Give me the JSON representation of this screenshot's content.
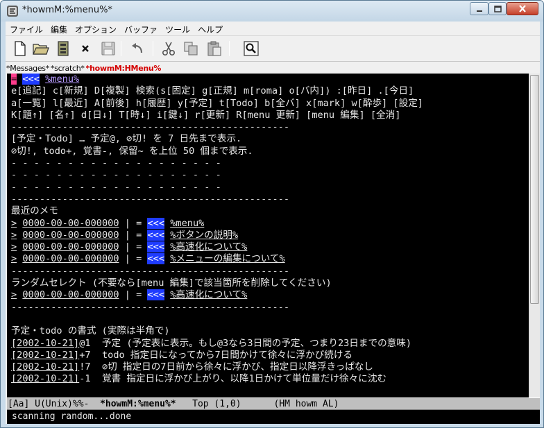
{
  "window": {
    "title": "*howmM:%menu%*",
    "controls": {
      "minimize": "minimize",
      "maximize": "maximize",
      "close": "close"
    }
  },
  "menubar": [
    "ファイル",
    "編集",
    "オプション",
    "バッファ",
    "ツール",
    "ヘルプ"
  ],
  "toolbar": {
    "icons": [
      "new-file-icon",
      "open-folder-icon",
      "save-disk-icon",
      "close-x-icon",
      "save-as-icon",
      "undo-icon",
      "cut-icon",
      "copy-icon",
      "paste-icon",
      "search-icon"
    ]
  },
  "tabs": [
    "*Messages*",
    "*scratch*",
    "*howmM:HMenu%"
  ],
  "editor": {
    "header": {
      "marker": "=",
      "back": "<<<",
      "name": "%menu%"
    },
    "menu_lines": [
      "e[追記] c[新規] D[複製] 検索(s[固定] g[正規] m[roma] o[バ内]) :[昨日] .[今日]",
      "a[一覧] l[最近] A[前後] h[履歴] y[予定] t[Todo] b[全バ] x[mark] w[酔歩] [設定]",
      "K[題↑] [名↑] d[日↓] T[時↓] i[鍵↓] r[更新] R[menu 更新] [menu 編集] [全消]"
    ],
    "separator": "-------------------------------------------------",
    "schedule_notes": [
      "[予定・Todo] … 予定@, ⊘切! を 7 日先まで表示.",
      "⊘切!, todo+, 覚書-, 保留~ を上位 50 個まで表示."
    ],
    "dashed_line": "- - - - - - - - - - - - - - - - - - -",
    "recent_title": "最近のメモ",
    "recent_items": [
      {
        "prefix": ">",
        "date": "0000-00-00-000000",
        "sep": "|",
        "eq": "=",
        "back": "<<<",
        "name": "%menu%"
      },
      {
        "prefix": ">",
        "date": "0000-00-00-000000",
        "sep": "|",
        "eq": "=",
        "back": "<<<",
        "name": "%ボタンの説明%"
      },
      {
        "prefix": ">",
        "date": "0000-00-00-000000",
        "sep": "|",
        "eq": "=",
        "back": "<<<",
        "name": "%高速化について%"
      },
      {
        "prefix": ">",
        "date": "0000-00-00-000000",
        "sep": "|",
        "eq": "=",
        "back": "<<<",
        "name": "%メニューの編集について%"
      }
    ],
    "random_title": "ランダムセレクト (不要なら[menu 編集]で該当箇所を削除してください)",
    "random_items": [
      {
        "prefix": ">",
        "date": "0000-00-00-000000",
        "sep": "|",
        "eq": "=",
        "back": "<<<",
        "name": "%高速化について%"
      }
    ],
    "format_title": "予定・todo の書式 (実際は半角で)",
    "format_lines": [
      {
        "date": "[2002-10-21]",
        "mark": "@1",
        "text": "  予定 (予定表に表示。もし@3なら3日間の予定、つまり23日までの意味)"
      },
      {
        "date": "[2002-10-21]",
        "mark": "+7",
        "text": "  todo 指定日になってから7日間かけて徐々に浮かび続ける"
      },
      {
        "date": "[2002-10-21]",
        "mark": "!7",
        "text": "  ⊘切 指定日の7日前から徐々に浮かび、指定日以降浮きっぱなし"
      },
      {
        "date": "[2002-10-21]",
        "mark": "-1",
        "text": "  覚書 指定日に浮かび上がり、以降1日かけて単位量だけ徐々に沈む"
      }
    ]
  },
  "modeline": {
    "left": "[Aa] U(Unix)%%-  ",
    "buffer": "*howmM:%menu%*",
    "right": "   Top (1,0)      (HM howm AL)"
  },
  "minibuffer": "scanning random...done"
}
